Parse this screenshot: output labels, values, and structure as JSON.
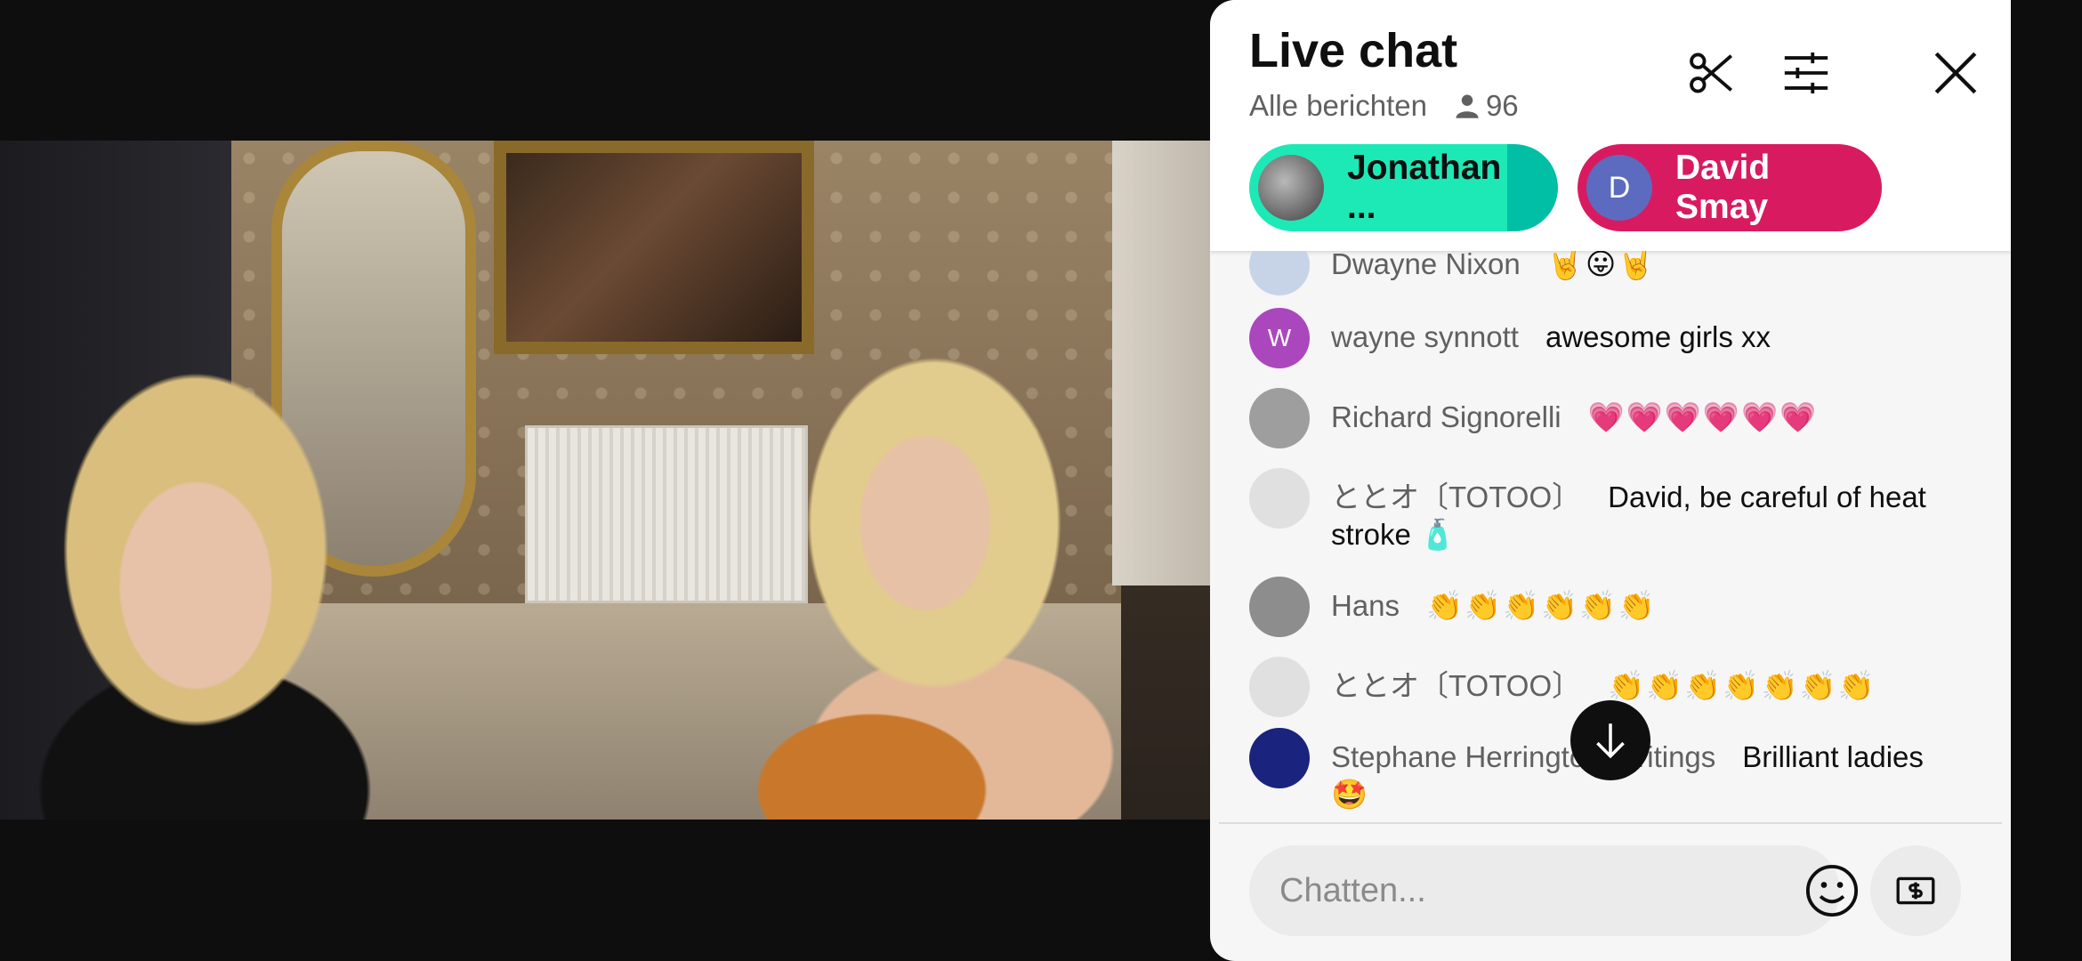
{
  "chat": {
    "title": "Live chat",
    "filter_label": "Alle berichten",
    "viewer_count": "96",
    "icons": [
      "scissors-icon",
      "sliders-icon",
      "close-icon",
      "person-icon",
      "arrow-down-icon",
      "emoji-icon",
      "money-icon"
    ]
  },
  "chips": [
    {
      "label": "Jonathan ...",
      "avatar_letter": "",
      "color": "#1de9b6"
    },
    {
      "label": "David Smay",
      "avatar_letter": "D",
      "color": "#d81b60"
    }
  ],
  "messages": [
    {
      "author": "Dwayne Nixon",
      "text": "🤘😛🤘",
      "avatar_letter": "",
      "avatar_color": "#c7d4e8"
    },
    {
      "author": "wayne synnott",
      "text": "awesome girls xx",
      "avatar_letter": "W",
      "avatar_color": "#ab47bc"
    },
    {
      "author": "Richard Signorelli",
      "text": "💗💗💗💗💗💗",
      "avatar_letter": "",
      "avatar_color": "#9e9e9e"
    },
    {
      "author": "ととオ〔TOTOO〕",
      "text": "David, be careful of heat stroke 🧴",
      "avatar_letter": "",
      "avatar_color": "#e0e0e0"
    },
    {
      "author": "Hans",
      "text": "👏👏👏👏👏👏",
      "avatar_letter": "",
      "avatar_color": "#8d8d8d"
    },
    {
      "author": "ととオ〔TOTOO〕",
      "text": "👏👏👏👏👏👏👏",
      "avatar_letter": "",
      "avatar_color": "#e0e0e0"
    },
    {
      "author": "Stephane Herrington Writings",
      "text": "Brilliant ladies 🤩",
      "avatar_letter": "",
      "avatar_color": "#1a237e"
    }
  ],
  "input": {
    "placeholder": "Chatten..."
  }
}
